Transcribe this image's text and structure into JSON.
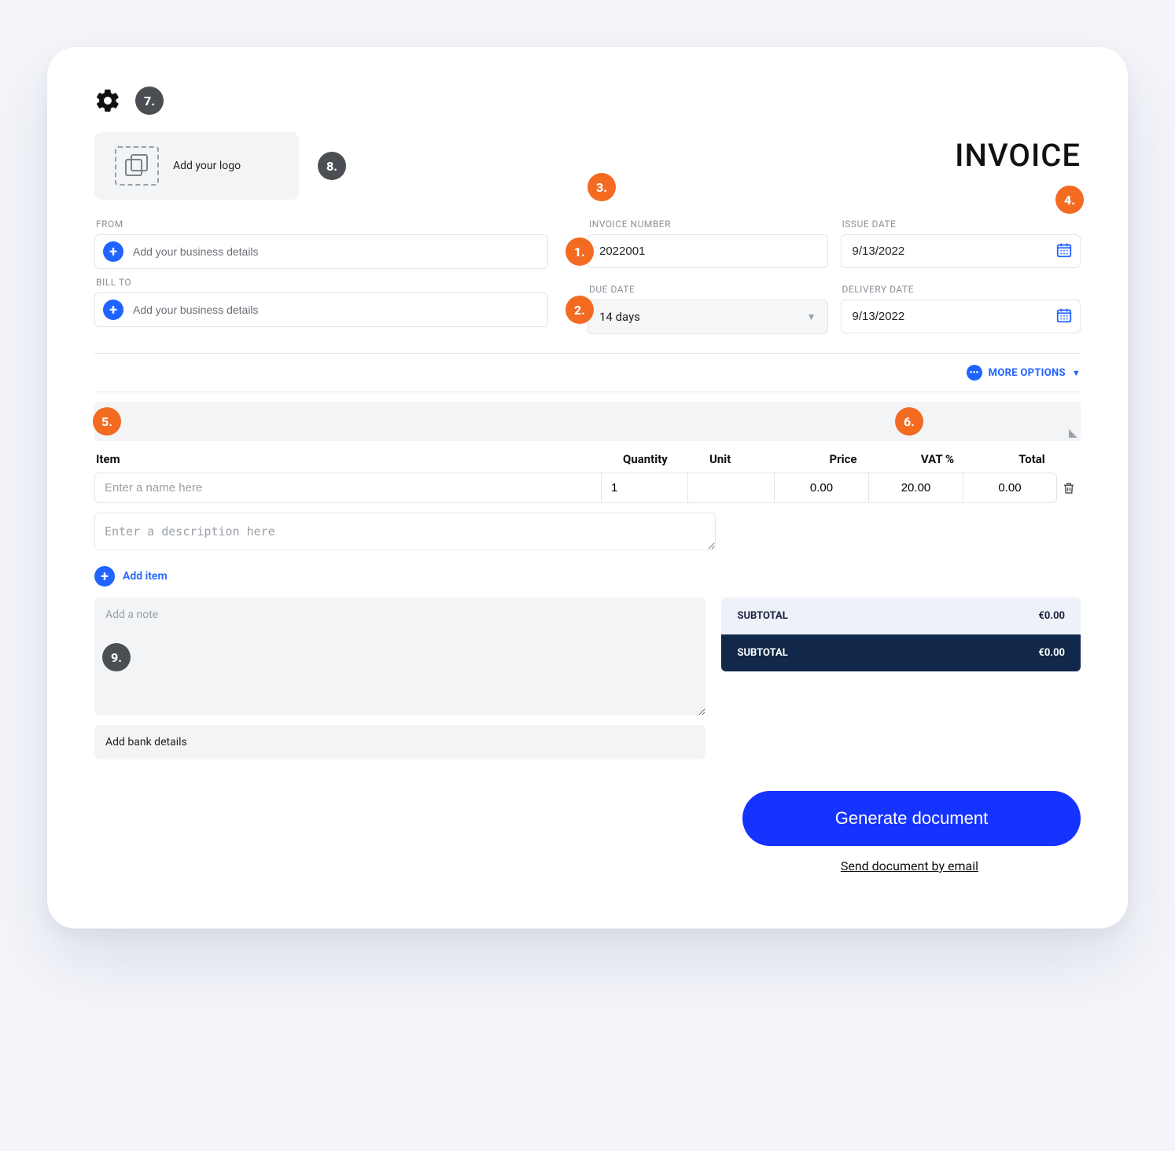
{
  "title": "INVOICE",
  "logo_cta": "Add your logo",
  "from": {
    "label": "FROM",
    "placeholder": "Add your business details"
  },
  "bill_to": {
    "label": "BILL TO",
    "placeholder": "Add your business details"
  },
  "fields": {
    "invoice_number": {
      "label": "INVOICE NUMBER",
      "value": "2022001"
    },
    "issue_date": {
      "label": "ISSUE DATE",
      "value": "9/13/2022"
    },
    "due_date": {
      "label": "DUE DATE",
      "value": "14 days"
    },
    "delivery_date": {
      "label": "DELIVERY DATE",
      "value": "9/13/2022"
    }
  },
  "more_options": "MORE OPTIONS",
  "items": {
    "headers": {
      "item": "Item",
      "quantity": "Quantity",
      "unit": "Unit",
      "price": "Price",
      "vat": "VAT %",
      "total": "Total"
    },
    "row": {
      "name_placeholder": "Enter a name here",
      "desc_placeholder": "Enter a description here",
      "quantity": "1",
      "unit": "",
      "price": "0.00",
      "vat": "20.00",
      "total": "0.00"
    },
    "add_item": "Add item"
  },
  "note_placeholder": "Add a note",
  "bank_details": "Add bank details",
  "totals": {
    "subtotal_label": "SUBTOTAL",
    "subtotal_value": "€0.00",
    "grand_label": "SUBTOTAL",
    "grand_value": "€0.00"
  },
  "actions": {
    "generate": "Generate document",
    "email": "Send document by email"
  },
  "annotations": {
    "b1": "1.",
    "b2": "2.",
    "b3": "3.",
    "b4": "4.",
    "b5": "5.",
    "b6": "6.",
    "b7": "7.",
    "b8": "8.",
    "b9": "9."
  }
}
